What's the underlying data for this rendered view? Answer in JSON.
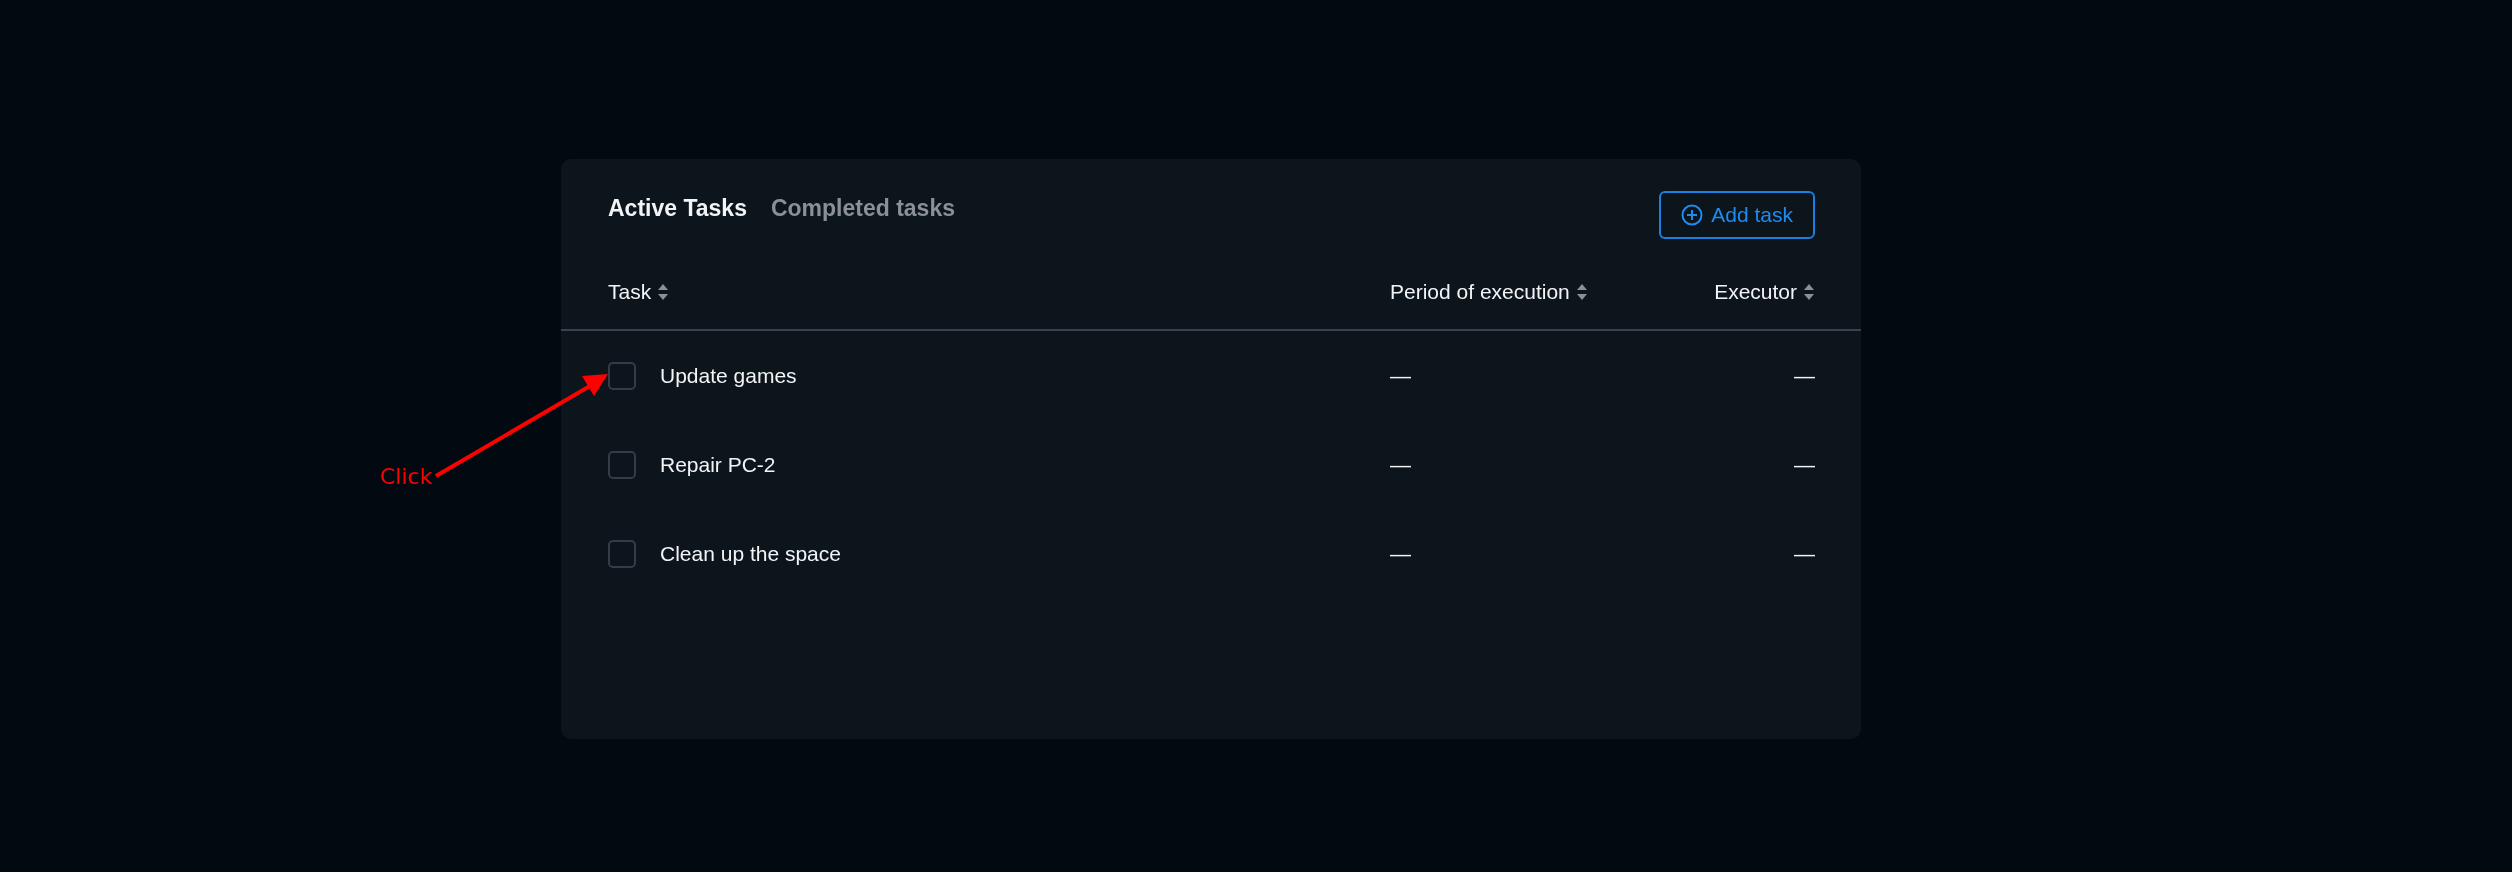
{
  "tabs": [
    {
      "label": "Active Tasks",
      "selected": true
    },
    {
      "label": "Completed tasks",
      "selected": false
    }
  ],
  "add_button": {
    "label": "Add task"
  },
  "table": {
    "columns": [
      "Task",
      "Period of execution",
      "Executor"
    ],
    "rows": [
      {
        "checked": false,
        "task": "Update games",
        "period": "—",
        "executor": "—"
      },
      {
        "checked": false,
        "task": "Repair PC-2",
        "period": "—",
        "executor": "—"
      },
      {
        "checked": false,
        "task": "Clean up the space",
        "period": "—",
        "executor": "—"
      }
    ]
  },
  "annotation": {
    "label": "Click"
  }
}
